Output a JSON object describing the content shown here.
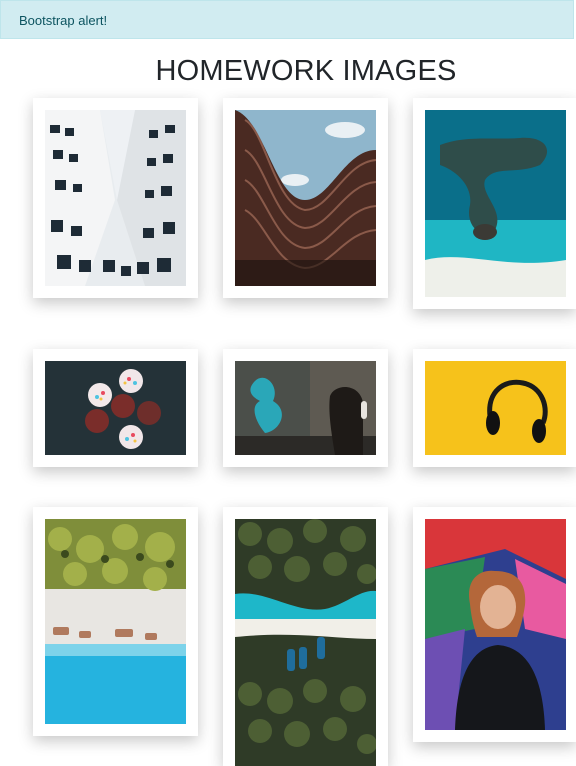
{
  "alert": {
    "text": "Bootstrap alert!"
  },
  "page": {
    "title": "HOMEWORK IMAGES"
  },
  "gallery": {
    "images": [
      {
        "subject": "building-courtyard-looking-up"
      },
      {
        "subject": "curved-building-facade"
      },
      {
        "subject": "aerial-ocean-reef"
      },
      {
        "subject": "cupcakes-top-view"
      },
      {
        "subject": "person-with-headphones-mural"
      },
      {
        "subject": "headphones-on-yellow"
      },
      {
        "subject": "aerial-beach-palms"
      },
      {
        "subject": "aerial-palms-boats"
      },
      {
        "subject": "person-with-graffiti"
      }
    ]
  }
}
